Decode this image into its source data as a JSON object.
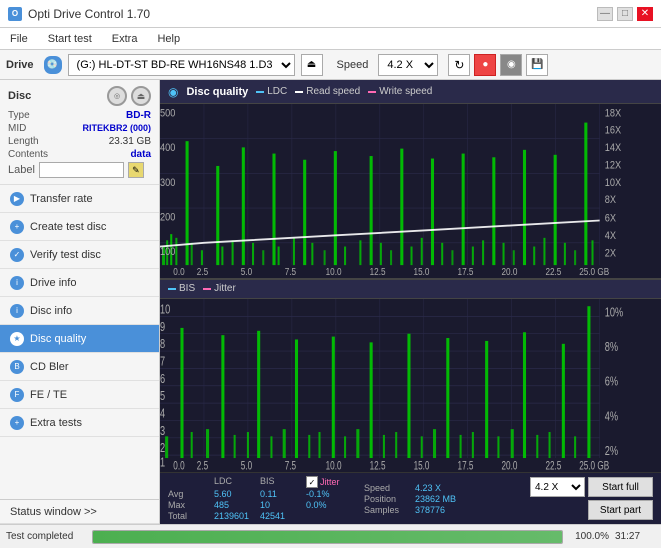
{
  "titleBar": {
    "title": "Opti Drive Control 1.70",
    "minBtn": "—",
    "maxBtn": "□",
    "closeBtn": "✕"
  },
  "menuBar": {
    "items": [
      "File",
      "Start test",
      "Extra",
      "Help"
    ]
  },
  "driveBar": {
    "label": "Drive",
    "driveValue": "(G:)  HL-DT-ST BD-RE  WH16NS48 1.D3",
    "speedLabel": "Speed",
    "speedValue": "4.2 X"
  },
  "disc": {
    "title": "Disc",
    "typeLabel": "Type",
    "typeValue": "BD-R",
    "midLabel": "MID",
    "midValue": "RITEKBR2 (000)",
    "lengthLabel": "Length",
    "lengthValue": "23.31 GB",
    "contentsLabel": "Contents",
    "contentsValue": "data",
    "labelLabel": "Label",
    "labelValue": ""
  },
  "navItems": [
    {
      "id": "transfer-rate",
      "label": "Transfer rate",
      "active": false
    },
    {
      "id": "create-test-disc",
      "label": "Create test disc",
      "active": false
    },
    {
      "id": "verify-test-disc",
      "label": "Verify test disc",
      "active": false
    },
    {
      "id": "drive-info",
      "label": "Drive info",
      "active": false
    },
    {
      "id": "disc-info",
      "label": "Disc info",
      "active": false
    },
    {
      "id": "disc-quality",
      "label": "Disc quality",
      "active": true
    },
    {
      "id": "cd-bler",
      "label": "CD Bler",
      "active": false
    },
    {
      "id": "fe-te",
      "label": "FE / TE",
      "active": false
    },
    {
      "id": "extra-tests",
      "label": "Extra tests",
      "active": false
    }
  ],
  "statusWindow": {
    "label": "Status window >>"
  },
  "charts": {
    "title": "Disc quality",
    "legend": {
      "ldc": "LDC",
      "readSpeed": "Read speed",
      "writeSpeed": "Write speed",
      "bis": "BIS",
      "jitter": "Jitter"
    },
    "topChart": {
      "yLabels": [
        "18X",
        "16X",
        "14X",
        "12X",
        "10X",
        "8X",
        "6X",
        "4X",
        "2X"
      ],
      "yMax": 500,
      "yTicks": [
        500,
        400,
        300,
        200,
        100
      ],
      "xLabels": [
        "0.0",
        "2.5",
        "5.0",
        "7.5",
        "10.0",
        "12.5",
        "15.0",
        "17.5",
        "20.0",
        "22.5",
        "25.0 GB"
      ]
    },
    "bottomChart": {
      "yLabels": [
        "10%",
        "8%",
        "6%",
        "4%",
        "2%"
      ],
      "yMax": 10,
      "yTicks": [
        "10",
        "9",
        "8",
        "7",
        "6",
        "5",
        "4",
        "3",
        "2",
        "1"
      ],
      "xLabels": [
        "0.0",
        "2.5",
        "5.0",
        "7.5",
        "10.0",
        "12.5",
        "15.0",
        "17.5",
        "20.0",
        "22.5",
        "25.0 GB"
      ]
    }
  },
  "stats": {
    "ldcLabel": "LDC",
    "bisLabel": "BIS",
    "jitterLabel": "Jitter",
    "speedLabel": "Speed",
    "positionLabel": "Position",
    "samplesLabel": "Samples",
    "avgLabel": "Avg",
    "maxLabel": "Max",
    "totalLabel": "Total",
    "avgLdc": "5.60",
    "avgBis": "0.11",
    "avgJitter": "-0.1%",
    "maxLdc": "485",
    "maxBis": "10",
    "maxJitter": "0.0%",
    "totalLdc": "2139601",
    "totalBis": "42541",
    "speedVal": "4.23 X",
    "positionVal": "23862 MB",
    "samplesVal": "378776",
    "startFull": "Start full",
    "startPart": "Start part",
    "speedDropdown": "4.2 X"
  },
  "bottomBar": {
    "statusText": "Test completed",
    "progressPct": 100,
    "progressLabel": "100.0%",
    "timeLabel": "31:27"
  }
}
